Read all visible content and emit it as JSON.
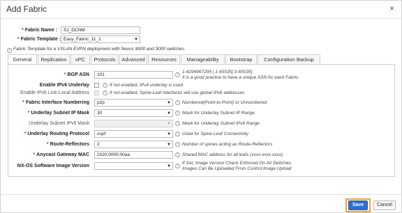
{
  "dialog": {
    "title": "Add Fabric",
    "close_glyph": "×"
  },
  "fabric_name": {
    "label": "Fabric Name :",
    "value": "SJ_DCNM"
  },
  "fabric_template": {
    "label": "Fabric Template :",
    "value": "Easy_Fabric_11_1"
  },
  "template_note": "Fabric Template for a VXLAN EVPN deployment with Nexus 9000 and 3000 switches.",
  "tabs": [
    {
      "label": "General",
      "active": true
    },
    {
      "label": "Replication"
    },
    {
      "label": "vPC"
    },
    {
      "label": "Protocols"
    },
    {
      "label": "Advanced"
    },
    {
      "label": "Resources"
    },
    {
      "label": "Manageability"
    },
    {
      "label": "Bootstrap"
    },
    {
      "label": "Configuration Backup"
    }
  ],
  "fields": {
    "bgp_asn": {
      "label": "BGP ASN",
      "value": "101",
      "hint1": "1-4294967295 | 1-65535[.0-65535]",
      "hint2": "It is a good practice to have a unique ASN for each Fabric."
    },
    "enable_ipv6_underlay": {
      "label": "Enable IPv6 Underlay",
      "hint": "If not enabled, IPv4 underlay is used"
    },
    "enable_ipv6_link_local": {
      "label": "Enable IPv6 Link-Local Address",
      "hint": "If not enabled, Spine-Leaf interfaces will use global IPv6 addresses"
    },
    "fabric_interface_numbering": {
      "label": "Fabric Interface Numbering",
      "value": "p2p",
      "hint": "Numbered(Point-to-Point) or Unnumbered"
    },
    "underlay_subnet_ip_mask": {
      "label": "Underlay Subnet IP Mask",
      "value": "30",
      "hint": "Mask for Underlay Subnet IP Range"
    },
    "underlay_subnet_ipv6_mask": {
      "label": "Underlay Subnet IPv6 Mask",
      "value": "",
      "hint": "Mask for Underlay Subnet IPv6 Range"
    },
    "underlay_routing_protocol": {
      "label": "Underlay Routing Protocol",
      "value": "ospf",
      "hint": "Used for Spine-Leaf Connectivity"
    },
    "route_reflectors": {
      "label": "Route-Reflectors",
      "value": "2",
      "hint": "Number of spines acting as Route-Reflectors"
    },
    "anycast_gateway_mac": {
      "label": "Anycast Gateway MAC",
      "value": "2020.0000.00aa",
      "hint": "Shared MAC address for all leafs (xxxx.xxxx.xxxx)"
    },
    "nxos_image_version": {
      "label": "NX-OS Software Image Version",
      "value": "",
      "hint1": "If Set, Image Version Check Enforced On All Switches.",
      "hint2": "Images Can Be Uploaded From Control:Image Upload"
    }
  },
  "icons": {
    "info": "i",
    "caret": "▼"
  },
  "footer": {
    "save_label": "Save",
    "cancel_label": "Cancel"
  },
  "colors": {
    "required": "#d9232d",
    "primary": "#2b6fd6",
    "focus": "#f2a32a"
  }
}
